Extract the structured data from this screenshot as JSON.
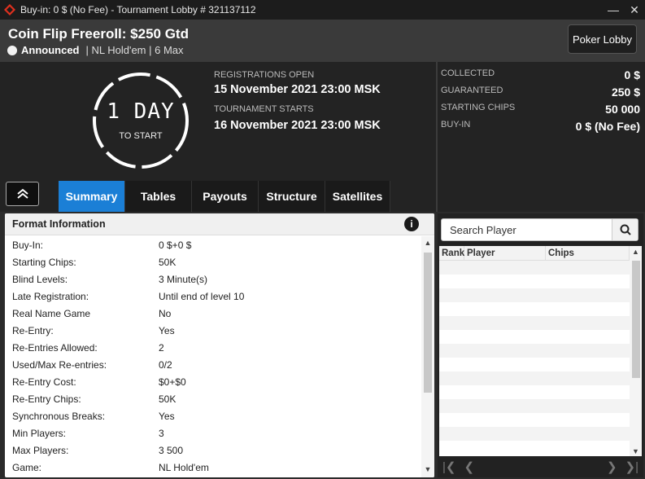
{
  "window": {
    "title": "Buy-in: 0 $ (No Fee) - Tournament Lobby # 321137112",
    "minimize_icon": "minimize-icon",
    "close_icon": "close-icon"
  },
  "header": {
    "tournament_name": "Coin Flip Freeroll: $250 Gtd",
    "status": "Announced",
    "game_info": "| NL Hold'em | 6 Max",
    "lobby_button": "Poker Lobby"
  },
  "countdown": {
    "value": "1 DAY",
    "caption": "TO START"
  },
  "schedule": {
    "registrations_label": "REGISTRATIONS OPEN",
    "registrations_value": "15 November 2021   23:00 MSK",
    "starts_label": "TOURNAMENT STARTS",
    "starts_value": "16 November 2021   23:00 MSK"
  },
  "stats": [
    {
      "label": "COLLECTED",
      "value": "0 $"
    },
    {
      "label": "GUARANTEED",
      "value": "250 $"
    },
    {
      "label": "STARTING CHIPS",
      "value": "50 000"
    },
    {
      "label": "BUY-IN",
      "value": "0 $ (No Fee)"
    }
  ],
  "tabs": [
    "Summary",
    "Tables",
    "Payouts",
    "Structure",
    "Satellites"
  ],
  "active_tab": "Summary",
  "format": {
    "heading": "Format Information",
    "rows": [
      {
        "key": "Buy-In:",
        "value": "0 $+0 $"
      },
      {
        "key": "Starting Chips:",
        "value": "50K"
      },
      {
        "key": "Blind Levels:",
        "value": "3 Minute(s)"
      },
      {
        "key": "Late Registration:",
        "value": "Until end of level 10"
      },
      {
        "key": "Real Name Game",
        "value": "No"
      },
      {
        "key": "Re-Entry:",
        "value": "Yes"
      },
      {
        "key": "Re-Entries Allowed:",
        "value": "2"
      },
      {
        "key": "Used/Max Re-entries:",
        "value": "0/2"
      },
      {
        "key": "Re-Entry Cost:",
        "value": "$0+$0"
      },
      {
        "key": "Re-Entry Chips:",
        "value": "50K"
      },
      {
        "key": "Synchronous Breaks:",
        "value": "Yes"
      },
      {
        "key": "Min Players:",
        "value": "3"
      },
      {
        "key": "Max Players:",
        "value": "3 500"
      },
      {
        "key": "Game:",
        "value": "NL Hold'em"
      }
    ]
  },
  "players": {
    "search_placeholder": "Search Player",
    "columns": [
      "Rank",
      "Player",
      "Chips"
    ]
  },
  "colors": {
    "accent": "#1b7fd6",
    "logo": "#e0301e"
  }
}
